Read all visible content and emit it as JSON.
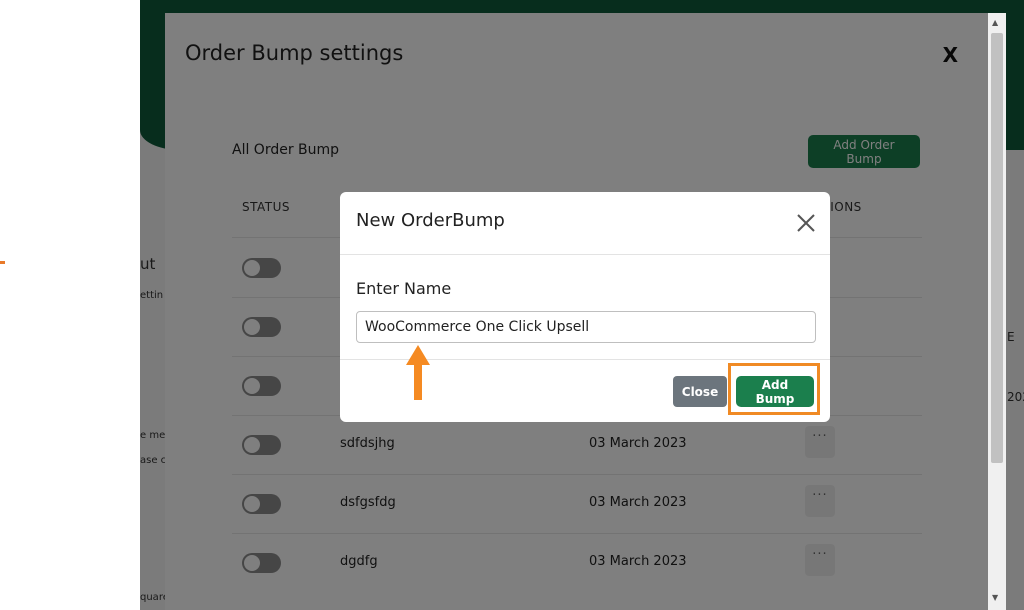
{
  "background": {
    "fragments": [
      "ut",
      "ettin",
      "e me",
      "ase c",
      "quare"
    ],
    "right_fragments": [
      "E",
      "202"
    ]
  },
  "outer_modal": {
    "title": "Order Bump settings",
    "close_label": "X",
    "section_title": "All Order Bump",
    "add_button": "Add Order Bump",
    "columns": [
      "STATUS",
      "ACTIONS"
    ],
    "rows": [
      {
        "name": "sdfdsjhg",
        "date": "03 March 2023"
      },
      {
        "name": "dsfgsfdg",
        "date": "03 March 2023"
      },
      {
        "name": "dgdfg",
        "date": "03 March 2023"
      }
    ],
    "more_label": "..."
  },
  "dialog": {
    "title": "New OrderBump",
    "label": "Enter Name",
    "input_value": "WooCommerce One Click Upsell",
    "close_button": "Close",
    "add_button": "Add Bump"
  },
  "colors": {
    "primary": "#1b7f4d",
    "highlight": "#f08a24",
    "secondary": "#6c757d"
  }
}
